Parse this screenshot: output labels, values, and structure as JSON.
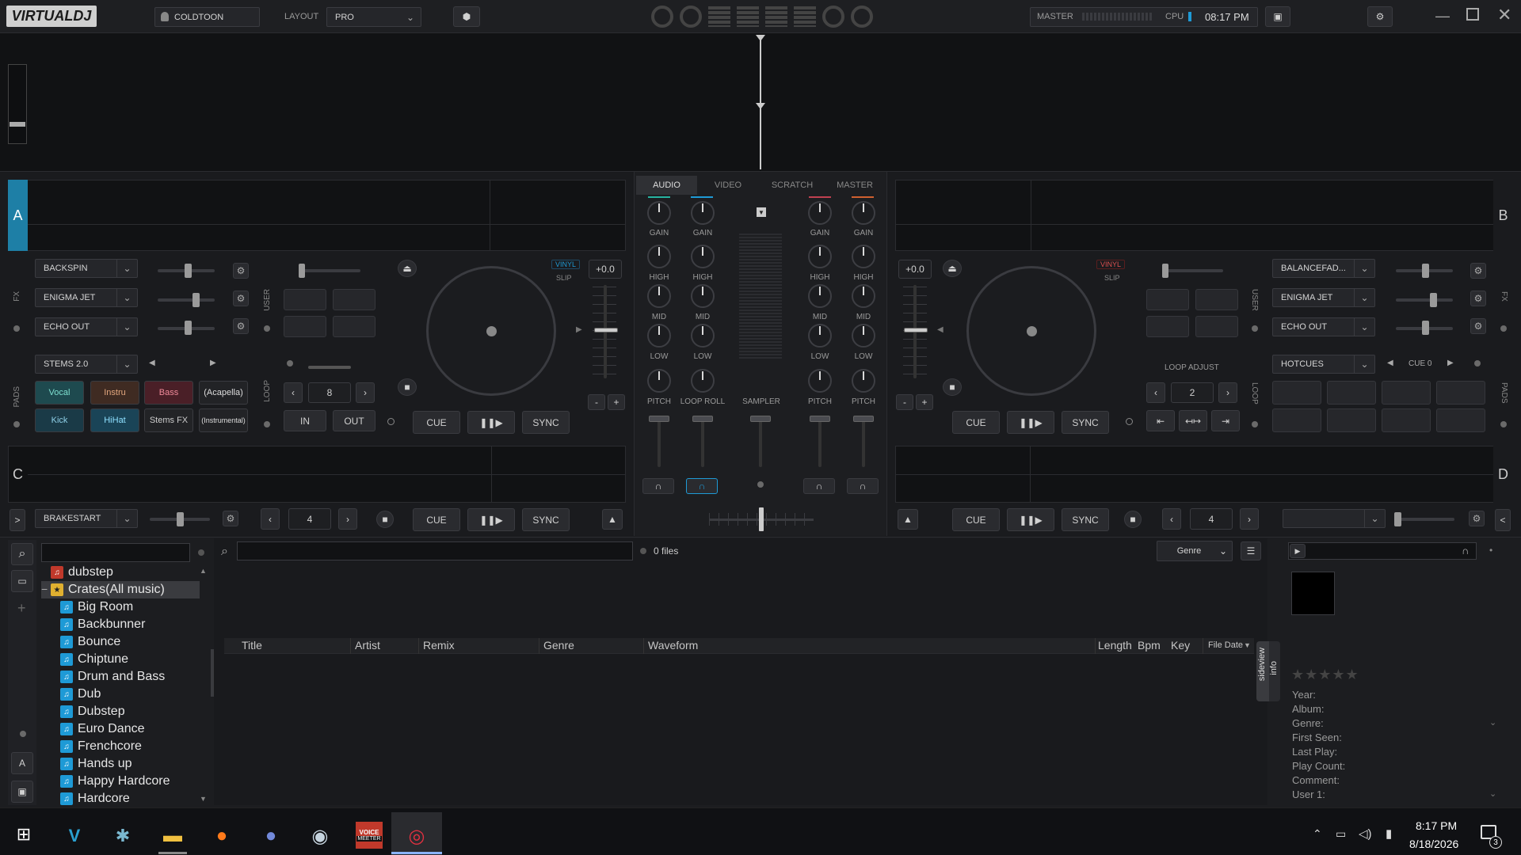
{
  "app": {
    "logo": "VIRTUALDJ",
    "user": "COLDTOON",
    "layout_label": "LAYOUT",
    "layout_value": "PRO",
    "master_label": "MASTER",
    "cpu_label": "CPU",
    "clock": "08:17 PM"
  },
  "colors": {
    "accent": "#1e9ad6",
    "bg": "#1a1b1e",
    "deck_a": "#1e7fa6",
    "vinyl_red": "#c0392b"
  },
  "deckA": {
    "letter": "A",
    "fx": [
      "BACKSPIN",
      "ENIGMA JET",
      "ECHO OUT"
    ],
    "fx_label": "FX",
    "user_label": "USER",
    "vinyl": "VINYL",
    "slip": "SLIP",
    "pitch": "+0.0",
    "stems_dd": "STEMS 2.0",
    "stems": [
      "Vocal",
      "Instru",
      "Bass",
      "(Acapella)",
      "Kick",
      "HiHat",
      "Stems FX",
      "(Instrumental)"
    ],
    "pads_label": "PADS",
    "loop_label": "LOOP",
    "loop_value": "8",
    "in": "IN",
    "out": "OUT",
    "cue": "CUE",
    "sync": "SYNC"
  },
  "deckB": {
    "letter": "B",
    "fx": [
      "BALANCEFAD...",
      "ENIGMA JET",
      "ECHO OUT"
    ],
    "fx_label": "FX",
    "user_label": "USER",
    "vinyl": "VINYL",
    "slip": "SLIP",
    "pitch": "+0.0",
    "loop_adjust": "LOOP ADJUST",
    "loop_value": "2",
    "hotcues": "HOTCUES",
    "cue_num": "CUE 0",
    "pads_label": "PADS",
    "loop_label": "LOOP",
    "cue": "CUE",
    "sync": "SYNC"
  },
  "deckC": {
    "letter": "C",
    "fx": "BRAKESTART",
    "loop_value": "4",
    "cue": "CUE",
    "sync": "SYNC"
  },
  "deckD": {
    "letter": "D",
    "loop_value": "4",
    "cue": "CUE",
    "sync": "SYNC"
  },
  "mixer": {
    "tabs": [
      "AUDIO",
      "VIDEO",
      "SCRATCH",
      "MASTER"
    ],
    "gain": "GAIN",
    "high": "HIGH",
    "mid": "MID",
    "low": "LOW",
    "pitch": "PITCH",
    "loop_roll": "LOOP ROLL",
    "sampler": "SAMPLER"
  },
  "browser": {
    "files": "0 files",
    "genre": "Genre",
    "folders_tab": "folders",
    "sideview_tab": "sideview",
    "info_tab": "info",
    "tree": [
      "dubstep",
      "Crates(All music)",
      "Big Room",
      "Backbunner",
      "Bounce",
      "Chiptune",
      "Drum and Bass",
      "Dub",
      "Dubstep",
      "Euro Dance",
      "Frenchcore",
      "Hands up",
      "Happy Hardcore",
      "Hardcore"
    ],
    "columns": [
      "Title",
      "Artist",
      "Remix",
      "Genre",
      "Waveform",
      "Length",
      "Bpm",
      "Key",
      "File Date"
    ]
  },
  "info": {
    "stars": "★★★★★",
    "fields": [
      "Year:",
      "Album:",
      "Genre:",
      "First Seen:",
      "Last Play:",
      "Play Count:",
      "Comment:",
      "User 1:"
    ]
  },
  "taskbar": {
    "time": "8:17 PM",
    "date": "8/18/2026",
    "notif_count": "3",
    "voicemeeter": [
      "VOICE",
      "MEETER"
    ]
  }
}
